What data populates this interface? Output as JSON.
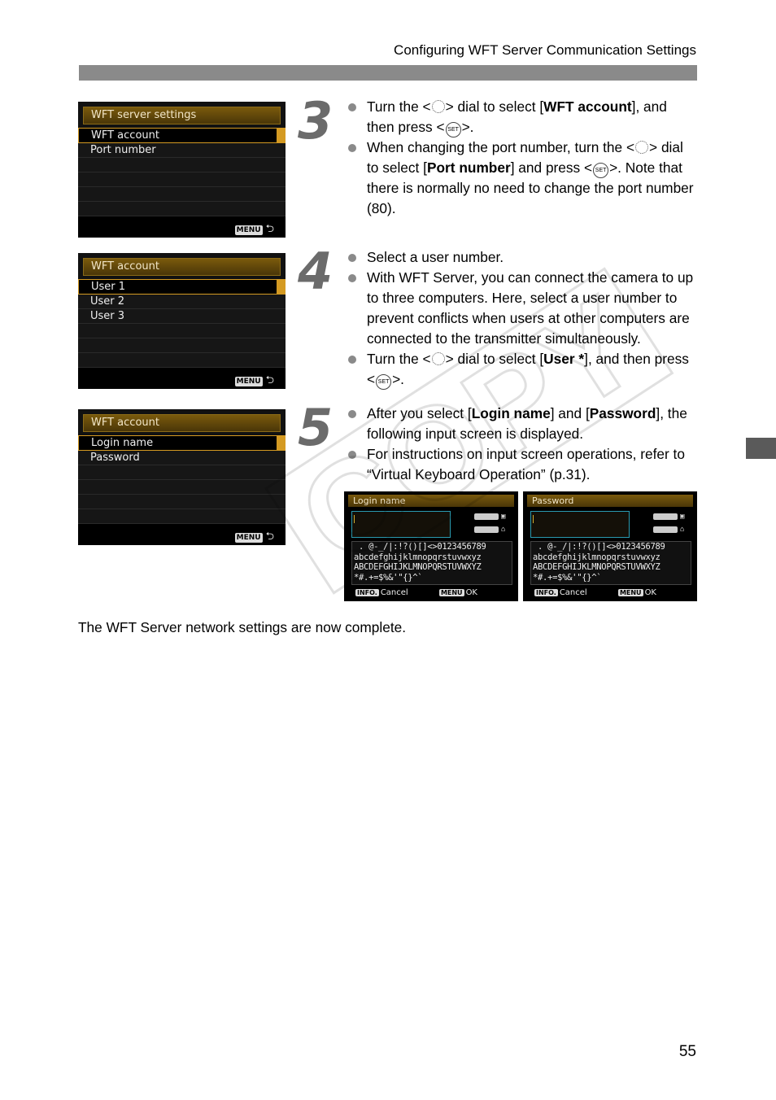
{
  "header": {
    "running_title": "Configuring WFT Server Communication Settings"
  },
  "page_number": "55",
  "watermark": "COPY",
  "screens": [
    {
      "title": "WFT server settings",
      "items": [
        "WFT account",
        "Port number"
      ],
      "selected": 0,
      "footer_button": "MENU"
    },
    {
      "title": "WFT account",
      "items": [
        "User 1",
        "User 2",
        "User 3"
      ],
      "selected": 0,
      "footer_button": "MENU"
    },
    {
      "title": "WFT account",
      "items": [
        "Login name",
        "Password"
      ],
      "selected": 0,
      "footer_button": "MENU"
    }
  ],
  "steps": [
    {
      "number": "3",
      "bullets": [
        {
          "parts": [
            "Turn the <",
            "dial",
            "> dial to select [",
            "b:WFT account",
            "], and then press <",
            "set",
            ">."
          ]
        },
        {
          "parts": [
            "When changing the port number, turn the <",
            "dial",
            "> dial to select [",
            "b:Port number",
            "] and press <",
            "set",
            ">. Note that there is normally no need to change the port number (80)."
          ]
        }
      ]
    },
    {
      "number": "4",
      "bullets": [
        {
          "parts": [
            "Select a user number."
          ]
        },
        {
          "parts": [
            "With WFT Server, you can connect the camera to up to three computers. Here, select a user number to prevent conflicts when users at other computers are connected to the transmitter simultaneously."
          ]
        },
        {
          "parts": [
            "Turn the <",
            "dial",
            "> dial to select [",
            "b:User *",
            "], and then press <",
            "set",
            ">."
          ]
        }
      ]
    },
    {
      "number": "5",
      "bullets": [
        {
          "parts": [
            "After you select [",
            "b:Login name",
            "] and [",
            "b:Password",
            "], the following input screen is displayed."
          ]
        },
        {
          "parts": [
            "For instructions on input screen operations, refer to “Virtual Keyboard Operation” (p.31)."
          ]
        }
      ]
    }
  ],
  "keyboards": [
    {
      "title": "Login name",
      "chars": [
        " . @-_/|:!?()[]<>0123456789",
        "abcdefghijklmnopqrstuvwxyz",
        "ABCDEFGHIJKLMNOPQRSTUVWXYZ",
        "*#.+=$%&'\"{}^`"
      ],
      "cancel_badge": "INFO.",
      "cancel_label": "Cancel",
      "ok_badge": "MENU",
      "ok_label": "OK"
    },
    {
      "title": "Password",
      "chars": [
        " . @-_/|:!?()[]<>0123456789",
        "abcdefghijklmnopqrstuvwxyz",
        "ABCDEFGHIJKLMNOPQRSTUVWXYZ",
        "*#.+=$%&'\"{}^`"
      ],
      "cancel_badge": "INFO.",
      "cancel_label": "Cancel",
      "ok_badge": "MENU",
      "ok_label": "OK"
    }
  ],
  "closing_text": "The WFT Server network settings are now complete."
}
